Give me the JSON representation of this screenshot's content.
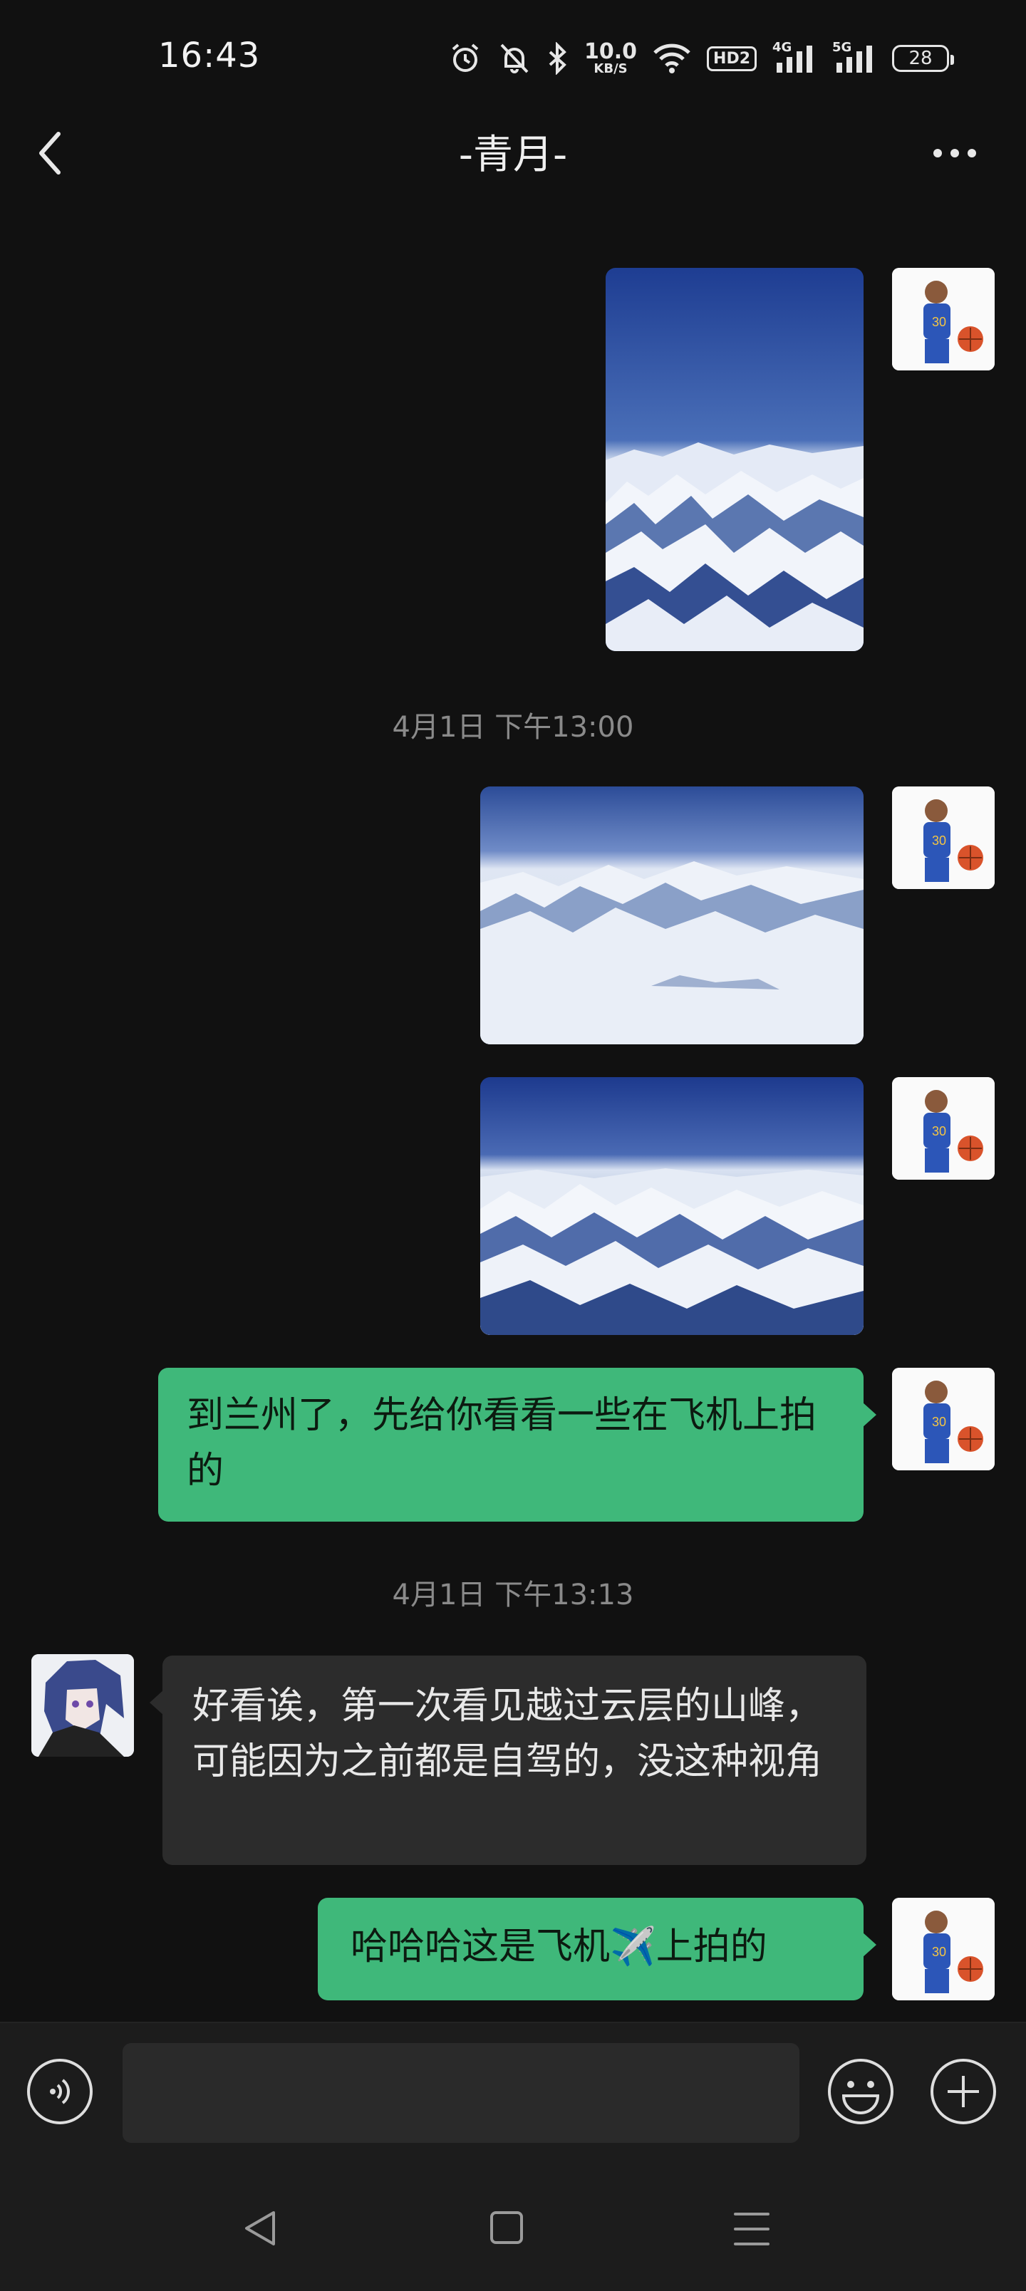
{
  "status_bar": {
    "time": "16:43",
    "net_speed": "10.0",
    "net_speed_unit": "KB/S",
    "hd_label": "HD2",
    "signal1_label": "4G",
    "signal2_label": "5G",
    "battery": "28",
    "icons": [
      "alarm-icon",
      "mute-icon",
      "bluetooth-icon",
      "wifi-icon",
      "hd-icon",
      "signal-4g-icon",
      "signal-5g-icon",
      "battery-icon"
    ]
  },
  "header": {
    "title": "-青月-",
    "back_icon": "chevron-left-icon",
    "more_icon": "more-icon"
  },
  "messages": {
    "ts1": "4月1日 下午13:00",
    "msg_green_1": "到兰州了，先给你看看一些在飞机上拍的",
    "ts2": "4月1日 下午13:13",
    "msg_gray_1": "好看诶，第一次看见越过云层的山峰，可能因为之前都是自驾的，没这种视角",
    "msg_green_2_a": "哈哈哈这是飞机",
    "msg_green_2_emoji": "✈️",
    "msg_green_2_b": "上拍的"
  },
  "input": {
    "value": "",
    "placeholder": ""
  },
  "colors": {
    "background": "#111111",
    "bubble_green": "#3fb87a",
    "bubble_gray": "#2c2c2c"
  }
}
